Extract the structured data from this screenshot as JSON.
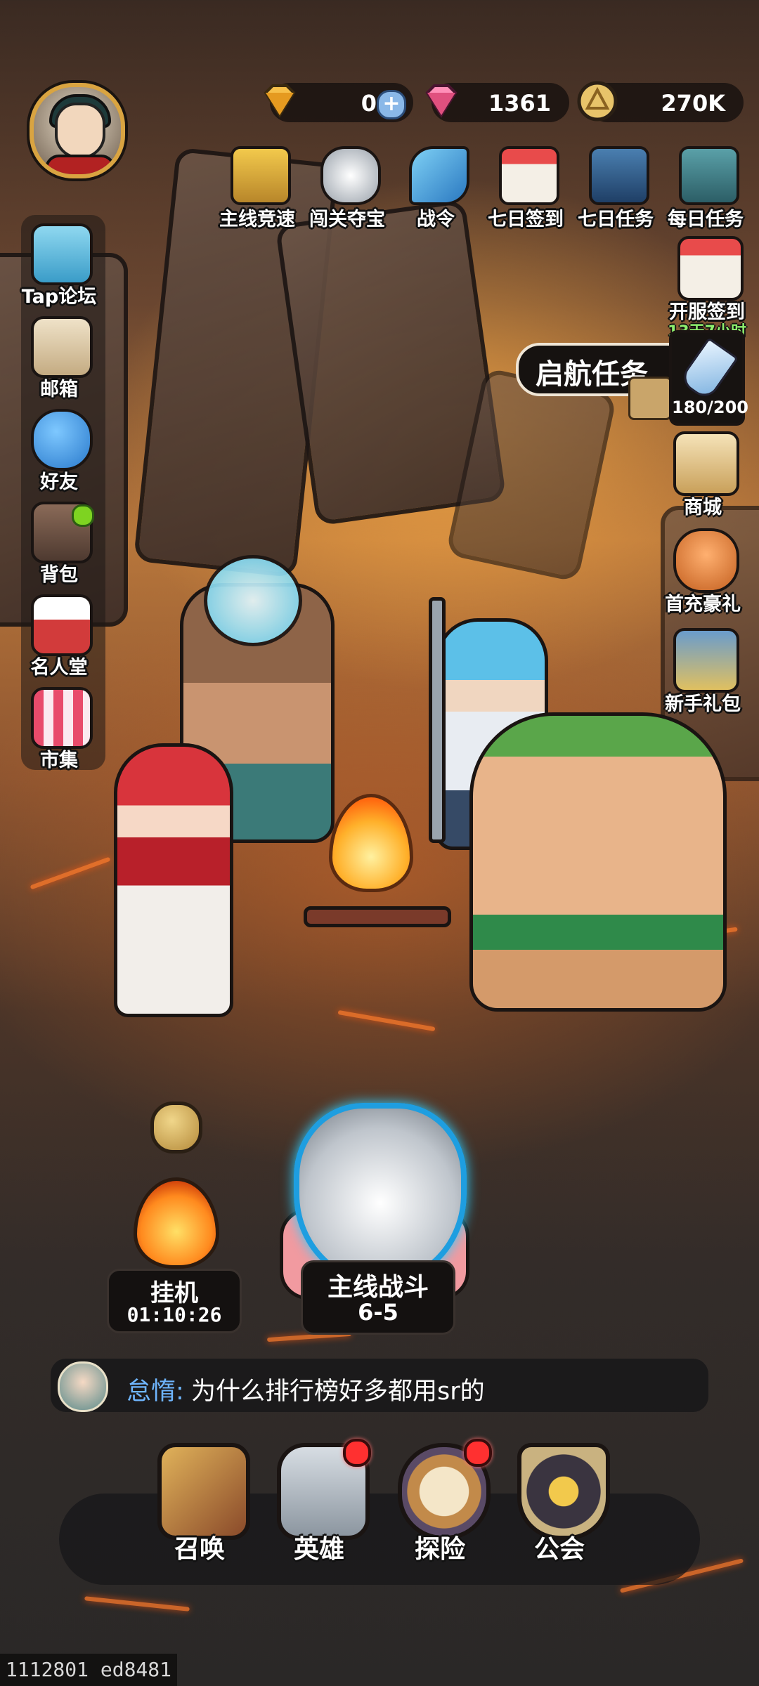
{
  "currency": {
    "gold_gem": {
      "value": "0",
      "icon": "gold-diamond-icon"
    },
    "pink_gem": {
      "value": "1361",
      "icon": "pink-diamond-icon"
    },
    "coin": {
      "value": "270K",
      "icon": "gold-coin-icon"
    }
  },
  "top_features": [
    {
      "label": "主线竞速",
      "icon": "trophy-icon"
    },
    {
      "label": "闯关夺宝",
      "icon": "wolf-crest-icon"
    },
    {
      "label": "战令",
      "icon": "feather-pass-icon"
    },
    {
      "label": "七日签到",
      "icon": "calendar-icon"
    },
    {
      "label": "七日任务",
      "icon": "helmet-task-icon"
    },
    {
      "label": "每日任务",
      "icon": "daily-board-icon"
    }
  ],
  "sidebar": [
    {
      "label": "Tap论坛",
      "icon": "chat-bubble-icon",
      "badge": false
    },
    {
      "label": "邮箱",
      "icon": "mail-icon",
      "badge": false
    },
    {
      "label": "好友",
      "icon": "friends-icon",
      "badge": false
    },
    {
      "label": "背包",
      "icon": "backpack-icon",
      "badge": true
    },
    {
      "label": "名人堂",
      "icon": "hall-of-fame-icon",
      "badge": false
    },
    {
      "label": "市集",
      "icon": "market-stall-icon",
      "badge": false
    }
  ],
  "right_side": {
    "server_signin": {
      "label": "开服签到",
      "sub": "13天7小时",
      "icon": "calendar-10-icon"
    },
    "quest": {
      "label": "启航任务",
      "progress": "180/200",
      "icon": "sword-icon"
    },
    "shop": {
      "label": "商城",
      "icon": "shop-bag-icon"
    },
    "first_recharge": {
      "label": "首充豪礼",
      "icon": "ssr-tiger-icon"
    },
    "newbie_pack": {
      "label": "新手礼包",
      "icon": "gift-pack-icon"
    }
  },
  "idle": {
    "label": "挂机",
    "time": "01:10:26"
  },
  "main_battle": {
    "label": "主线战斗",
    "stage": "6-5"
  },
  "chat": {
    "name": "怠惰:",
    "message": "为什么排行榜好多都用sr的"
  },
  "bottom_nav": [
    {
      "label": "召唤",
      "icon": "summon-book-icon",
      "badge": false
    },
    {
      "label": "英雄",
      "icon": "hero-helmet-icon",
      "badge": true
    },
    {
      "label": "探险",
      "icon": "compass-icon",
      "badge": true
    },
    {
      "label": "公会",
      "icon": "guild-shield-icon",
      "badge": false
    }
  ],
  "footer": "1112801 ed8481"
}
